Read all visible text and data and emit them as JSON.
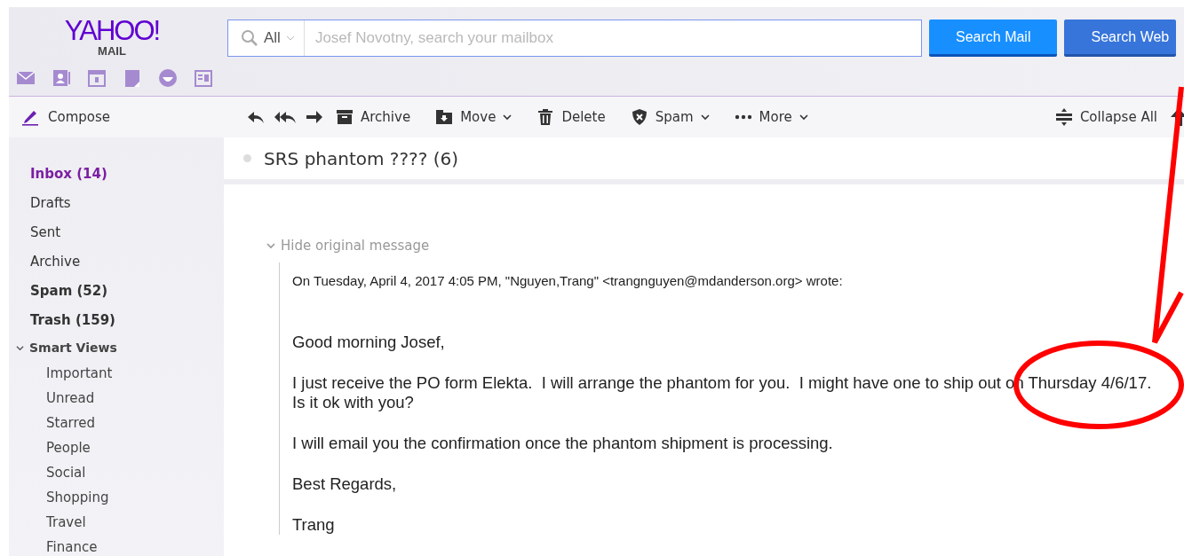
{
  "logo": {
    "name": "YAHOO!",
    "sub": "MAIL"
  },
  "search": {
    "scope": "All",
    "placeholder": "Josef Novotny, search your mailbox"
  },
  "search_buttons": [
    {
      "label": "Search Mail",
      "kind": "mail"
    },
    {
      "label": "Search Web",
      "kind": "web"
    }
  ],
  "compose": "Compose",
  "toolbar": [
    {
      "kind": "reply"
    },
    {
      "kind": "reply-all"
    },
    {
      "kind": "forward"
    },
    {
      "kind": "archive",
      "label": "Archive",
      "dropdown": false
    },
    {
      "kind": "move",
      "label": "Move",
      "dropdown": true
    },
    {
      "kind": "delete",
      "label": "Delete",
      "dropdown": false
    },
    {
      "kind": "spam",
      "label": "Spam",
      "dropdown": true
    },
    {
      "kind": "more",
      "label": "More",
      "dropdown": true
    }
  ],
  "collapse_all": "Collapse All",
  "folders": [
    {
      "label": "Inbox (14)",
      "selected": true,
      "unread": true
    },
    {
      "label": "Drafts",
      "selected": false,
      "unread": false
    },
    {
      "label": "Sent",
      "selected": false,
      "unread": false
    },
    {
      "label": "Archive",
      "selected": false,
      "unread": false
    },
    {
      "label": "Spam (52)",
      "selected": false,
      "unread": true
    },
    {
      "label": "Trash (159)",
      "selected": false,
      "unread": true
    }
  ],
  "smart_views": {
    "label": "Smart Views",
    "expanded": true,
    "children": [
      {
        "label": "Important",
        "selected": false
      },
      {
        "label": "Unread",
        "selected": false
      },
      {
        "label": "Starred",
        "selected": false
      },
      {
        "label": "People",
        "selected": false
      },
      {
        "label": "Social",
        "selected": false
      },
      {
        "label": "Shopping",
        "selected": false
      },
      {
        "label": "Travel",
        "selected": false
      },
      {
        "label": "Finance",
        "selected": false
      }
    ]
  },
  "thread": {
    "subject": "SRS phantom ???? (6)"
  },
  "message": {
    "toggle": "Hide original message",
    "expanded": true,
    "quote_header": "On Tuesday, April 4, 2017 4:05 PM, \"Nguyen,Trang\" <trangnguyen@mdanderson.org> wrote:",
    "paragraphs": [
      "Good morning Josef,",
      "I just receive the PO form Elekta.  I will arrange the phantom for you.  I might have one to ship out on Thursday 4/6/17.  Is it ok with you?",
      "I will email you the confirmation once the phantom shipment is processing.",
      "Best Regards,",
      "Trang"
    ]
  }
}
